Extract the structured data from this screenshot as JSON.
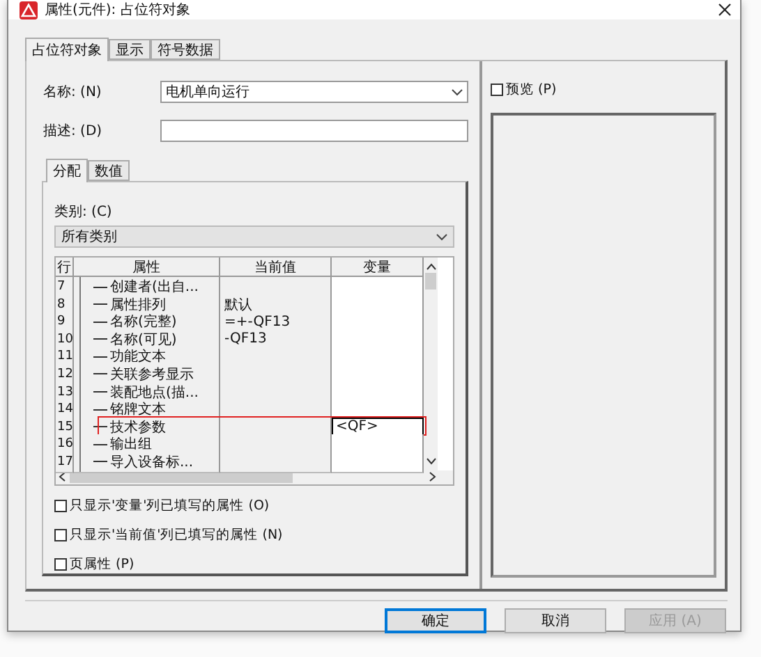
{
  "window": {
    "title": "属性(元件): 占位符对象"
  },
  "tabs": [
    {
      "label": "占位符对象",
      "selected": true
    },
    {
      "label": "显示",
      "selected": false
    },
    {
      "label": "符号数据",
      "selected": false
    }
  ],
  "fields": [
    {
      "label": "名称: (N)",
      "value": "电机单向运行",
      "kind": "dropdown"
    },
    {
      "label": "描述: (D)",
      "kind": "text"
    }
  ],
  "sub_tabs": [
    {
      "label": "分配",
      "selected": true
    },
    {
      "label": "数值",
      "selected": false
    }
  ],
  "category": {
    "label": "类别: (C)",
    "value": "所有类别"
  },
  "table": {
    "columns": [
      "行",
      "属性",
      "当前值",
      "变量"
    ],
    "rows": [
      {
        "row": "7",
        "property": "创建者(出自...",
        "highlighted": false
      },
      {
        "row": "8",
        "property": "属性排列",
        "value": "默认",
        "highlighted": false
      },
      {
        "row": "9",
        "property": "名称(完整)",
        "value": "=+-QF13",
        "highlighted": false
      },
      {
        "row": "10",
        "property": "名称(可见)",
        "value": "-QF13",
        "highlighted": false
      },
      {
        "row": "11",
        "property": "功能文本",
        "highlighted": false
      },
      {
        "row": "12",
        "property": "关联参考显示",
        "highlighted": false
      },
      {
        "row": "13",
        "property": "装配地点(描...",
        "highlighted": false
      },
      {
        "row": "14",
        "property": "铭牌文本",
        "highlighted": false
      },
      {
        "row": "15",
        "property": "技术参数",
        "variable": "<QF>",
        "highlighted": true
      },
      {
        "row": "16",
        "property": "输出组",
        "highlighted": false
      },
      {
        "row": "17",
        "property": "导入设备标...",
        "highlighted": false
      }
    ]
  },
  "options": [
    {
      "label": "只显示'变量'列已填写的属性 (O)",
      "checked": false
    },
    {
      "label": "只显示'当前值'列已填写的属性 (N)",
      "checked": false
    },
    {
      "label": "页属性 (P)",
      "checked": false
    }
  ],
  "preview": {
    "label": "预览 (P)",
    "checked": false
  },
  "buttons": [
    {
      "label": "确定",
      "kind": "default",
      "disabled": false
    },
    {
      "label": "取消",
      "kind": "normal",
      "disabled": false
    },
    {
      "label": "应用 (A)",
      "kind": "normal",
      "disabled": true
    }
  ]
}
